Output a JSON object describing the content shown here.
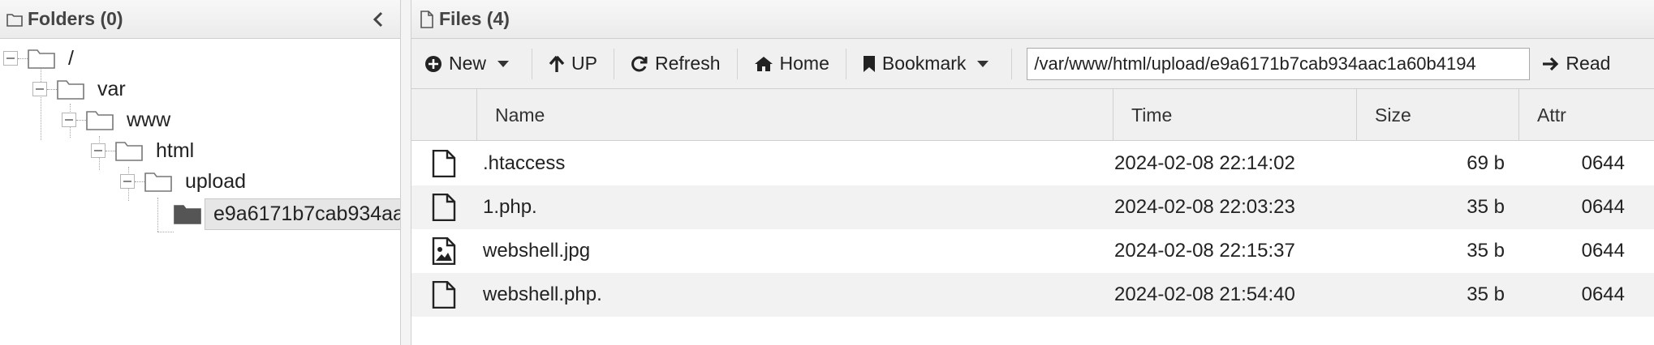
{
  "folders_panel": {
    "title": "Folders (0)",
    "tree": [
      {
        "label": "/",
        "level": 0
      },
      {
        "label": "var",
        "level": 1
      },
      {
        "label": "www",
        "level": 2
      },
      {
        "label": "html",
        "level": 3
      },
      {
        "label": "upload",
        "level": 4
      },
      {
        "label": "e9a6171b7cab934aa",
        "level": 5,
        "selected": true
      }
    ]
  },
  "files_panel": {
    "title": "Files (4)",
    "toolbar": {
      "new_label": "New",
      "up_label": "UP",
      "refresh_label": "Refresh",
      "home_label": "Home",
      "bookmark_label": "Bookmark",
      "path_value": "/var/www/html/upload/e9a6171b7cab934aac1a60b4194",
      "read_label": "Read"
    },
    "columns": [
      "Name",
      "Time",
      "Size",
      "Attr"
    ],
    "files": [
      {
        "icon": "file-icon",
        "name": ".htaccess",
        "time": "2024-02-08 22:14:02",
        "size": "69 b",
        "attr": "0644"
      },
      {
        "icon": "file-icon",
        "name": "1.php.",
        "time": "2024-02-08 22:03:23",
        "size": "35 b",
        "attr": "0644"
      },
      {
        "icon": "image-file-icon",
        "name": "webshell.jpg",
        "time": "2024-02-08 22:15:37",
        "size": "35 b",
        "attr": "0644"
      },
      {
        "icon": "file-icon",
        "name": "webshell.php.",
        "time": "2024-02-08 21:54:40",
        "size": "35 b",
        "attr": "0644"
      }
    ]
  },
  "colors": {
    "header_bg": "#ebebeb",
    "alt_row_bg": "#f2f2f2",
    "selected_bg": "#e6e6e6"
  }
}
